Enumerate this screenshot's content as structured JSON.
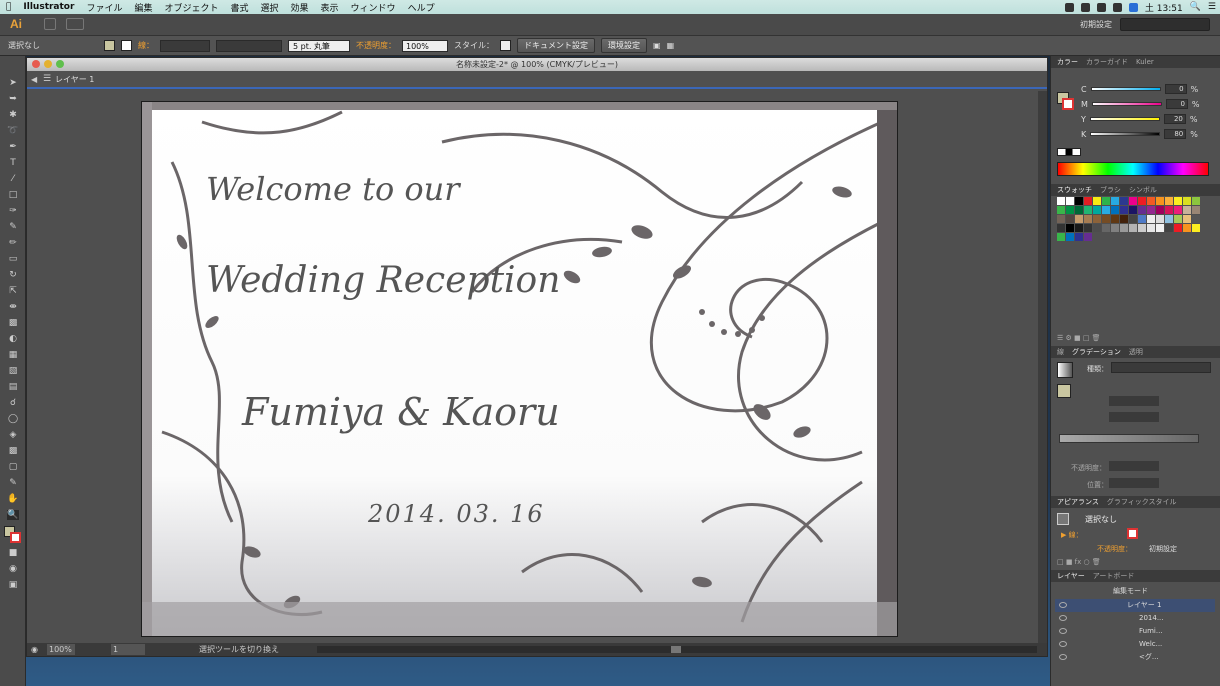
{
  "menubar": {
    "app": "Illustrator",
    "items": [
      "ファイル",
      "編集",
      "オブジェクト",
      "書式",
      "選択",
      "効果",
      "表示",
      "ウィンドウ",
      "ヘルプ"
    ],
    "clock": "土 13:51"
  },
  "appbar": {
    "logo": "Ai",
    "workspace": "初期設定"
  },
  "control": {
    "selection": "選択なし",
    "stroke_label": "線：",
    "brush": "5 pt. 丸筆",
    "opacity_label": "不透明度：",
    "opacity": "100%",
    "style_label": "スタイル：",
    "doc_settings": "ドキュメント設定",
    "prefs": "環境設定"
  },
  "document": {
    "title": "名称未設定-2* @ 100% (CMYK/プレビュー)",
    "layer": "レイヤー 1",
    "artwork": {
      "line1": "Welcome to our",
      "line2": "Wedding Reception",
      "names": "Fumiya & Kaoru",
      "date": "2014. 03. 16"
    },
    "status": {
      "zoom": "100%",
      "page": "1",
      "tool_hint": "選択ツールを切り換え"
    }
  },
  "panels": {
    "color": {
      "tabs": [
        "カラー",
        "カラーガイド",
        "Kuler"
      ],
      "channels": [
        {
          "name": "C",
          "value": "0",
          "color": "#00aeef"
        },
        {
          "name": "M",
          "value": "0",
          "color": "#ec008c"
        },
        {
          "name": "Y",
          "value": "20",
          "color": "#fff200"
        },
        {
          "name": "K",
          "value": "80",
          "color": "#000000"
        }
      ],
      "unit": "%"
    },
    "swatches": {
      "tabs": [
        "スウォッチ",
        "ブラシ",
        "シンボル"
      ]
    },
    "gradient": {
      "tabs": [
        "線",
        "グラデーション",
        "透明"
      ],
      "type_label": "種類：",
      "opacity_label": "不透明度：",
      "position_label": "位置："
    },
    "appearance": {
      "tabs": [
        "アピアランス",
        "グラフィックスタイル"
      ],
      "target": "選択なし",
      "stroke": "線：",
      "opacity": "不透明度：",
      "opacity_value": "初期設定"
    },
    "layers": {
      "tabs": [
        "レイヤー",
        "アートボード"
      ],
      "rows": [
        "編集モード",
        "レイヤー 1",
        "2014...",
        "Fumi...",
        "Welc...",
        "<グ..."
      ]
    }
  },
  "colors": {
    "accent": "#3b67b8",
    "logo": "#e8a23a",
    "artwork_gray": "#6b6668"
  }
}
